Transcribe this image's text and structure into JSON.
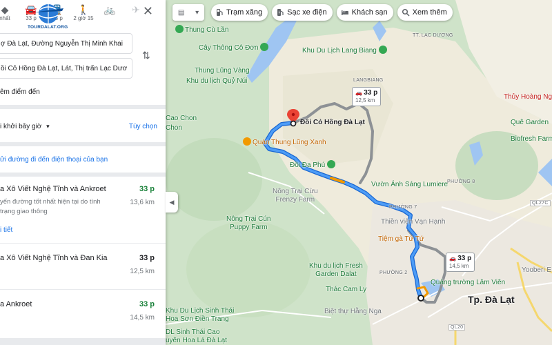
{
  "panel": {
    "modes": [
      {
        "icon": "best-route-icon",
        "label": "nhất"
      },
      {
        "icon": "car-icon",
        "label": "33 p"
      },
      {
        "icon": "transit-icon",
        "label": "33 p"
      },
      {
        "icon": "walk-icon",
        "label": "2 giờ 15"
      },
      {
        "icon": "bicycle-icon",
        "label": ""
      },
      {
        "icon": "flight-icon",
        "label": ""
      }
    ],
    "logo_text": "TOURDALAT.ORG",
    "origin_value": "ợ Đà Lạt, Đường Nguyễn Thị Minh Khai",
    "destination_value": "ồi Cỏ Hồng Đà Lạt, Lát, Thị trấn Lạc Dươ",
    "add_stop": "êm điểm đến",
    "depart_label": "i khởi bây giờ",
    "options_label": "Tùy chọn",
    "send_to_phone": "ửi đường đi đến điện thoại của bạn",
    "routes": [
      {
        "name": "a Xô Viết Nghệ Tĩnh và Ankroet",
        "time": "33 p",
        "distance": "13,6 km",
        "desc": "yến đường tốt nhất hiện tại do tình\ntrạng giao thông",
        "details": "i tiết",
        "fast": true
      },
      {
        "name": "a Xô Viết Nghệ Tĩnh và Đan Kia",
        "time": "33 p",
        "distance": "12,5 km",
        "fast": false
      },
      {
        "name": "a Ankroet",
        "time": "33 p",
        "distance": "14,5 km",
        "fast": true
      }
    ]
  },
  "map": {
    "chips": [
      {
        "icon": "gas-station-icon",
        "label": "Trạm xăng"
      },
      {
        "icon": "ev-charger-icon",
        "label": "Sạc xe điện"
      },
      {
        "icon": "hotel-icon",
        "label": "Khách sạn"
      },
      {
        "icon": "search-icon",
        "label": "Xem thêm"
      }
    ],
    "labels": {
      "cu_lan": "Thung Cù Lần",
      "cay_thong": "Cây Thông Cô Đơn",
      "lang_biang": "Khu Du Lịch Lang Biang",
      "tt_lac_duong": "TT. LẠC DƯƠNG",
      "langbiang": "LANGBIANG",
      "thung_lung_vang": "Thung Lũng Vàng",
      "quy_nui": "Khu du lịch Quỷ Núi",
      "cao_chon": "Cao Chon",
      "chon": "Chon",
      "doi_co_hong": "Đồi Cỏ Hồng Đà Lạt",
      "thuy_hoang_nga": "Thủy Hoàng Nga",
      "que_garden": "Quê Garden",
      "biofresh": "Biofresh Farm",
      "tlx": "Quán Thung Lũng Xanh",
      "doi_da_phu": "Đồi Đa Phú",
      "nong_trai_cuu": "Nông Trại Cừu\nFrenzy Farm",
      "vuon_anh_sang": "Vườn Ánh Sáng Lumiere",
      "phuong7": "PHƯỜNG 7",
      "phuong8": "PHƯỜNG 8",
      "phuong2": "PHƯỜNG 2",
      "nong_trai_cun": "Nông Trại Cún\nPuppy Farm",
      "thien_vien": "Thiền viện Vạn Hạnh",
      "tiem_ga": "Tiệm gà Tứ Tứ",
      "fresh_garden": "Khu du lịch Fresh\nGarden Dalat",
      "thac_cam_ly": "Thác Cam Ly",
      "quang_truong": "Quảng trường Lâm Viên",
      "tp_da_lat": "Tp. Đà Lạt",
      "sinh_thai": "Khu Du Lịch Sinh Thái\nHoa Sơn Điền Trang",
      "biet_thu": "Biệt thự Hằng Nga",
      "dl_sinh_thai": "DL Sinh Thái Cao\nuyên Hoa Lá Đà Lạt",
      "yooberi": "Yooberi E",
      "road_dt725": "DT725",
      "road_ql20": "QL20",
      "road_ql27c": "QL27C"
    },
    "route_boxes": [
      {
        "time": "33 p",
        "distance": "12,5 km"
      },
      {
        "time": "33 p",
        "distance": "14,5 km"
      }
    ]
  }
}
